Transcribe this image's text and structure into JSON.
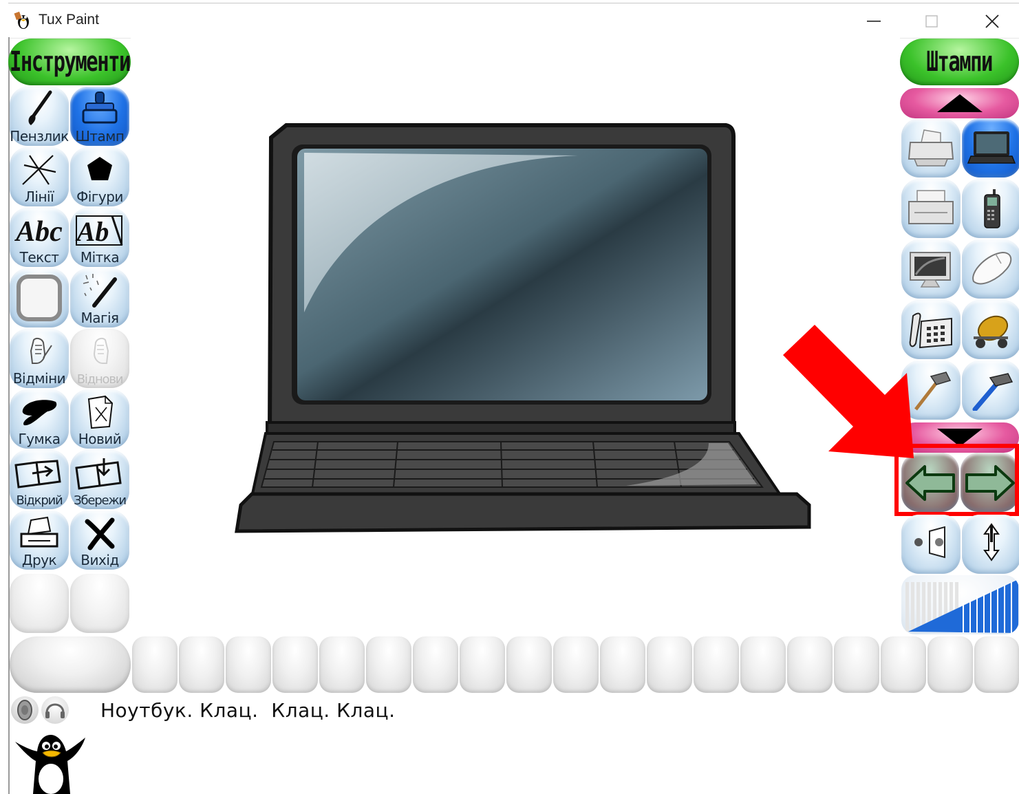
{
  "window": {
    "title": "Tux Paint",
    "app_icon": "tux-icon",
    "controls": [
      "minimize-icon",
      "maximize-icon",
      "close-icon"
    ]
  },
  "tools": {
    "header": "Інструменти",
    "items": [
      {
        "label": "Пензлик",
        "icon": "brush-icon",
        "selected": false
      },
      {
        "label": "Штамп",
        "icon": "stamp-icon",
        "selected": true
      },
      {
        "label": "Лінії",
        "icon": "lines-icon",
        "selected": false
      },
      {
        "label": "Фігури",
        "icon": "shapes-icon",
        "selected": false
      },
      {
        "label": "Текст",
        "icon": "text-icon",
        "selected": false
      },
      {
        "label": "Мітка",
        "icon": "label-icon",
        "selected": false
      },
      {
        "label": "",
        "icon": "fill-icon",
        "selected": false
      },
      {
        "label": "Магія",
        "icon": "magic-icon",
        "selected": false
      },
      {
        "label": "Відміни",
        "icon": "undo-icon",
        "selected": false
      },
      {
        "label": "Віднови",
        "icon": "redo-icon",
        "selected": false,
        "disabled": true
      },
      {
        "label": "Гумка",
        "icon": "eraser-icon",
        "selected": false
      },
      {
        "label": "Новий",
        "icon": "new-icon",
        "selected": false
      },
      {
        "label": "Відкрий",
        "icon": "open-icon",
        "selected": false
      },
      {
        "label": "Збережи",
        "icon": "save-icon",
        "selected": false
      },
      {
        "label": "Друк",
        "icon": "print-icon",
        "selected": false
      },
      {
        "label": "Вихід",
        "icon": "quit-icon",
        "selected": false
      }
    ]
  },
  "stamps": {
    "header": "Штампи",
    "scroll_up": "triangle-up-icon",
    "scroll_down": "triangle-down-icon",
    "items": [
      {
        "icon": "printer-stamp-icon",
        "selected": false
      },
      {
        "icon": "laptop-stamp-icon",
        "selected": true
      },
      {
        "icon": "fax-stamp-icon",
        "selected": false
      },
      {
        "icon": "mobile-phone-stamp-icon",
        "selected": false
      },
      {
        "icon": "monitor-stamp-icon",
        "selected": false
      },
      {
        "icon": "mouse-stamp-icon",
        "selected": false
      },
      {
        "icon": "desk-phone-stamp-icon",
        "selected": false
      },
      {
        "icon": "cement-mixer-stamp-icon",
        "selected": false
      },
      {
        "icon": "hammer-stamp-icon",
        "selected": false
      },
      {
        "icon": "hammer-blue-stamp-icon",
        "selected": false
      }
    ],
    "prev_group": "arrow-left-icon",
    "next_group": "arrow-right-icon",
    "sound_toggle": "stamp-sound-icon",
    "flip_toggle": "flip-icon",
    "size_slider": "stamp-size-icon"
  },
  "status": {
    "message": "Ноутбук. Клац.  Клац. Клац.",
    "speaker_icons": [
      "speaker-icon",
      "headphones-icon"
    ],
    "mascot": "tux-mascot-icon"
  },
  "palette": {
    "count": 19
  },
  "colors": {
    "header_green": "#3bc22a",
    "selected_blue": "#1f72e6",
    "scroll_pink": "#e65aa0",
    "highlight_red": "#ff0000"
  }
}
